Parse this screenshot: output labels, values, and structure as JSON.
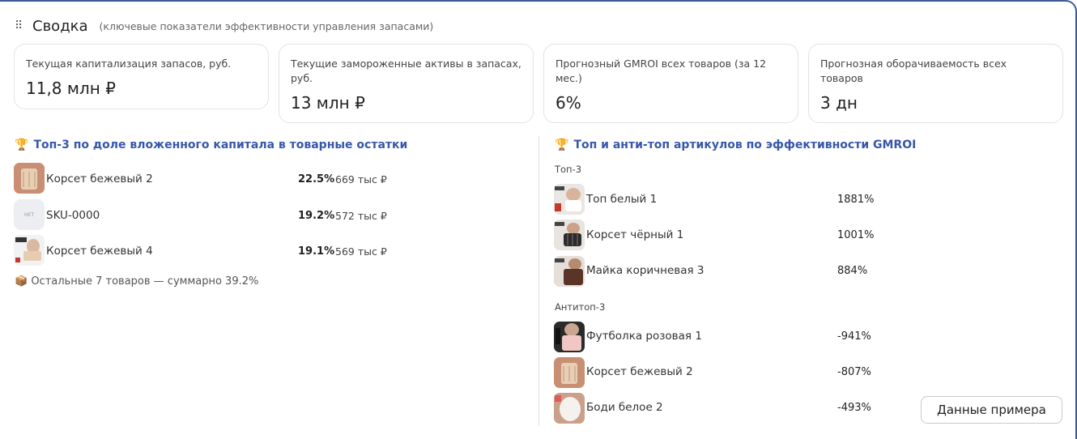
{
  "header": {
    "title": "Сводка",
    "subtitle": "(ключевые показатели эффективности управления запасами)"
  },
  "kpis": [
    {
      "label": "Текущая капитализация запасов, руб.",
      "value": "11,8 млн ₽"
    },
    {
      "label": "Текущие замороженные активы в запасах, руб.",
      "value": "13 млн ₽"
    },
    {
      "label": "Прогнозный GMROI всех товаров (за 12 мес.)",
      "value": "6%"
    },
    {
      "label": "Прогнозная оборачиваемость всех товаров",
      "value": "3 дн"
    }
  ],
  "capital": {
    "title": "Топ-3 по доле вложенного капитала в товарные остатки",
    "items": [
      {
        "name": "Корсет бежевый 2",
        "share": "22.5%",
        "amount": "669 тыс ₽",
        "thumb": "corset-beige"
      },
      {
        "name": "SKU-0000",
        "share": "19.2%",
        "amount": "572 тыс ₽",
        "thumb": "no-image",
        "thumb_text": "НЕТ"
      },
      {
        "name": "Корсет бежевый 4",
        "share": "19.1%",
        "amount": "569 тыс ₽",
        "thumb": "corset-beige-4"
      }
    ],
    "others": "Остальные 7 товаров — суммарно 39.2%"
  },
  "gmroi": {
    "title": "Топ и анти-топ артикулов по эффективности GMROI",
    "top_label": "Топ-3",
    "top": [
      {
        "name": "Топ белый 1",
        "value": "1881%",
        "thumb": "top-white"
      },
      {
        "name": "Корсет чёрный 1",
        "value": "1001%",
        "thumb": "corset-black"
      },
      {
        "name": "Майка коричневая 3",
        "value": "884%",
        "thumb": "tank-brown"
      }
    ],
    "anti_label": "Антитоп-3",
    "anti": [
      {
        "name": "Футболка розовая 1",
        "value": "-941%",
        "thumb": "tshirt-pink"
      },
      {
        "name": "Корсет бежевый 2",
        "value": "-807%",
        "thumb": "corset-beige"
      },
      {
        "name": "Боди белое 2",
        "value": "-493%",
        "thumb": "body-white"
      }
    ]
  },
  "button": {
    "label": "Данные примера"
  },
  "colors": {
    "accent": "#3757a8",
    "frame": "#3d5a98"
  }
}
